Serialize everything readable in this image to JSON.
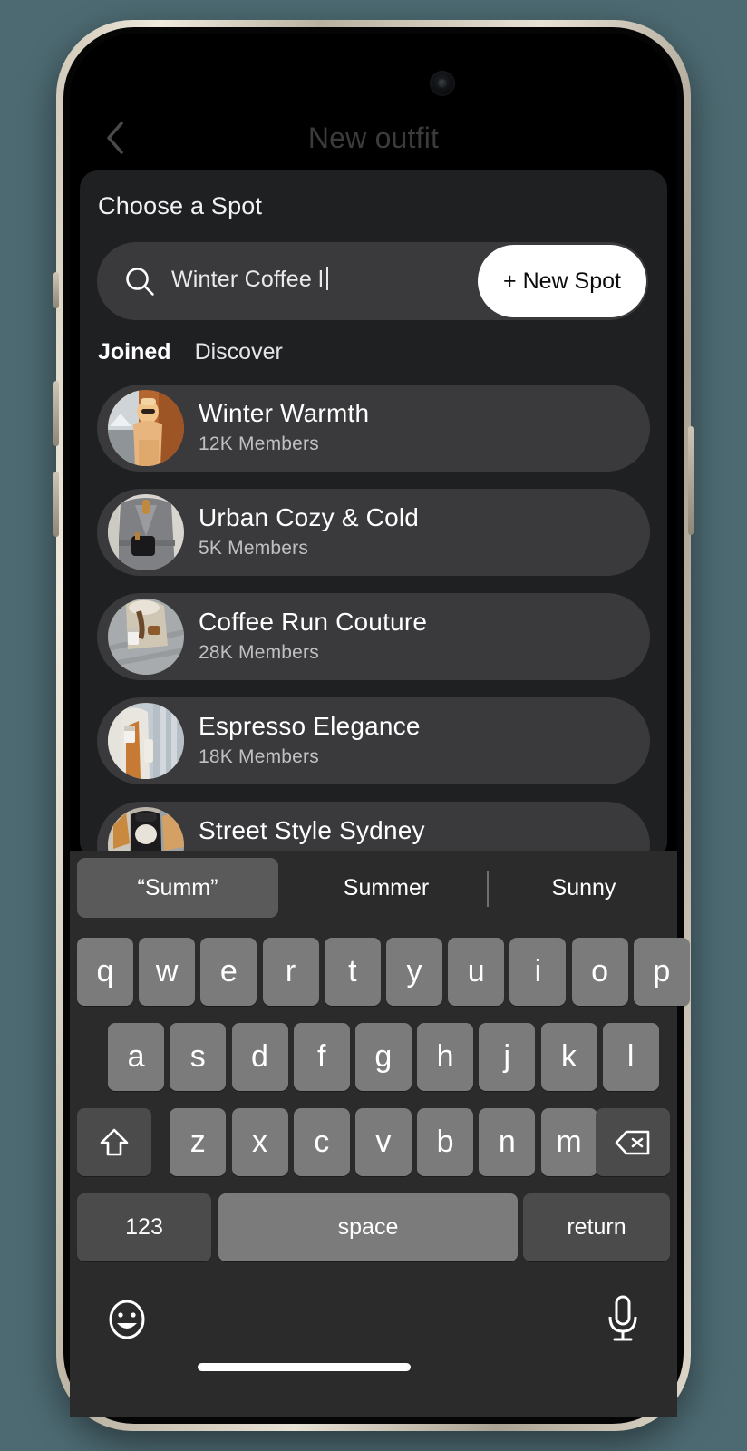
{
  "nav": {
    "back_icon": "chevron-left-icon",
    "title": "New outfit"
  },
  "sheet": {
    "title": "Choose a Spot",
    "search": {
      "icon": "search-icon",
      "value": "Winter Coffee l",
      "placeholder": "Search spots"
    },
    "new_spot_button": "+ New Spot",
    "tabs": [
      {
        "label": "Joined",
        "active": true
      },
      {
        "label": "Discover",
        "active": false
      }
    ],
    "spots": [
      {
        "name": "Winter Warmth",
        "members": "12K Members",
        "avatar": "winter-warmth-photo"
      },
      {
        "name": "Urban Cozy & Cold",
        "members": "5K Members",
        "avatar": "urban-cozy-photo"
      },
      {
        "name": "Coffee Run Couture",
        "members": "28K Members",
        "avatar": "coffee-run-photo"
      },
      {
        "name": "Espresso Elegance",
        "members": "18K Members",
        "avatar": "espresso-photo"
      },
      {
        "name": "Street Style Sydney",
        "members": "",
        "avatar": "street-style-photo"
      }
    ]
  },
  "keyboard": {
    "suggestions": [
      "“Summ”",
      "Summer",
      "Sunny"
    ],
    "row1": [
      "q",
      "w",
      "e",
      "r",
      "t",
      "y",
      "u",
      "i",
      "o",
      "p"
    ],
    "row2": [
      "a",
      "s",
      "d",
      "f",
      "g",
      "h",
      "j",
      "k",
      "l"
    ],
    "row3": [
      "z",
      "x",
      "c",
      "v",
      "b",
      "n",
      "m"
    ],
    "shift_icon": "shift-up-arrow-icon",
    "backspace_icon": "backspace-delete-icon",
    "numeric_key": "123",
    "space_key": "space",
    "return_key": "return",
    "emoji_icon": "emoji-smiley-icon",
    "mic_icon": "microphone-icon"
  },
  "colors": {
    "page_background": "#4d6a72",
    "sheet_background": "#1f2022",
    "row_background": "#3a3a3c",
    "accent_white": "#ffffff",
    "key_light": "#7b7b7b",
    "key_dark": "#4b4b4b",
    "keyboard_background": "#2b2b2b"
  }
}
